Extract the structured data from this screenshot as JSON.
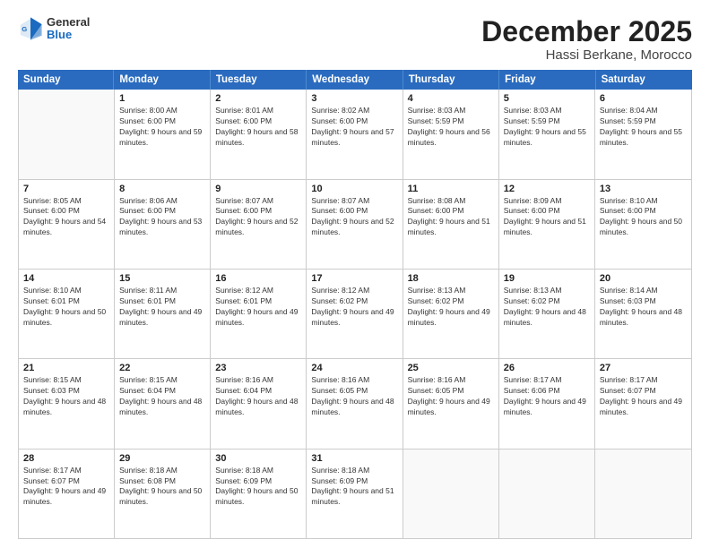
{
  "logo": {
    "general": "General",
    "blue": "Blue"
  },
  "title": "December 2025",
  "subtitle": "Hassi Berkane, Morocco",
  "days": [
    "Sunday",
    "Monday",
    "Tuesday",
    "Wednesday",
    "Thursday",
    "Friday",
    "Saturday"
  ],
  "weeks": [
    [
      {
        "day": "",
        "empty": true
      },
      {
        "day": "1",
        "sunrise": "8:00 AM",
        "sunset": "6:00 PM",
        "daylight": "9 hours and 59 minutes."
      },
      {
        "day": "2",
        "sunrise": "8:01 AM",
        "sunset": "6:00 PM",
        "daylight": "9 hours and 58 minutes."
      },
      {
        "day": "3",
        "sunrise": "8:02 AM",
        "sunset": "6:00 PM",
        "daylight": "9 hours and 57 minutes."
      },
      {
        "day": "4",
        "sunrise": "8:03 AM",
        "sunset": "5:59 PM",
        "daylight": "9 hours and 56 minutes."
      },
      {
        "day": "5",
        "sunrise": "8:03 AM",
        "sunset": "5:59 PM",
        "daylight": "9 hours and 55 minutes."
      },
      {
        "day": "6",
        "sunrise": "8:04 AM",
        "sunset": "5:59 PM",
        "daylight": "9 hours and 55 minutes."
      }
    ],
    [
      {
        "day": "7",
        "sunrise": "8:05 AM",
        "sunset": "6:00 PM",
        "daylight": "9 hours and 54 minutes."
      },
      {
        "day": "8",
        "sunrise": "8:06 AM",
        "sunset": "6:00 PM",
        "daylight": "9 hours and 53 minutes."
      },
      {
        "day": "9",
        "sunrise": "8:07 AM",
        "sunset": "6:00 PM",
        "daylight": "9 hours and 52 minutes."
      },
      {
        "day": "10",
        "sunrise": "8:07 AM",
        "sunset": "6:00 PM",
        "daylight": "9 hours and 52 minutes."
      },
      {
        "day": "11",
        "sunrise": "8:08 AM",
        "sunset": "6:00 PM",
        "daylight": "9 hours and 51 minutes."
      },
      {
        "day": "12",
        "sunrise": "8:09 AM",
        "sunset": "6:00 PM",
        "daylight": "9 hours and 51 minutes."
      },
      {
        "day": "13",
        "sunrise": "8:10 AM",
        "sunset": "6:00 PM",
        "daylight": "9 hours and 50 minutes."
      }
    ],
    [
      {
        "day": "14",
        "sunrise": "8:10 AM",
        "sunset": "6:01 PM",
        "daylight": "9 hours and 50 minutes."
      },
      {
        "day": "15",
        "sunrise": "8:11 AM",
        "sunset": "6:01 PM",
        "daylight": "9 hours and 49 minutes."
      },
      {
        "day": "16",
        "sunrise": "8:12 AM",
        "sunset": "6:01 PM",
        "daylight": "9 hours and 49 minutes."
      },
      {
        "day": "17",
        "sunrise": "8:12 AM",
        "sunset": "6:02 PM",
        "daylight": "9 hours and 49 minutes."
      },
      {
        "day": "18",
        "sunrise": "8:13 AM",
        "sunset": "6:02 PM",
        "daylight": "9 hours and 49 minutes."
      },
      {
        "day": "19",
        "sunrise": "8:13 AM",
        "sunset": "6:02 PM",
        "daylight": "9 hours and 48 minutes."
      },
      {
        "day": "20",
        "sunrise": "8:14 AM",
        "sunset": "6:03 PM",
        "daylight": "9 hours and 48 minutes."
      }
    ],
    [
      {
        "day": "21",
        "sunrise": "8:15 AM",
        "sunset": "6:03 PM",
        "daylight": "9 hours and 48 minutes."
      },
      {
        "day": "22",
        "sunrise": "8:15 AM",
        "sunset": "6:04 PM",
        "daylight": "9 hours and 48 minutes."
      },
      {
        "day": "23",
        "sunrise": "8:16 AM",
        "sunset": "6:04 PM",
        "daylight": "9 hours and 48 minutes."
      },
      {
        "day": "24",
        "sunrise": "8:16 AM",
        "sunset": "6:05 PM",
        "daylight": "9 hours and 48 minutes."
      },
      {
        "day": "25",
        "sunrise": "8:16 AM",
        "sunset": "6:05 PM",
        "daylight": "9 hours and 49 minutes."
      },
      {
        "day": "26",
        "sunrise": "8:17 AM",
        "sunset": "6:06 PM",
        "daylight": "9 hours and 49 minutes."
      },
      {
        "day": "27",
        "sunrise": "8:17 AM",
        "sunset": "6:07 PM",
        "daylight": "9 hours and 49 minutes."
      }
    ],
    [
      {
        "day": "28",
        "sunrise": "8:17 AM",
        "sunset": "6:07 PM",
        "daylight": "9 hours and 49 minutes."
      },
      {
        "day": "29",
        "sunrise": "8:18 AM",
        "sunset": "6:08 PM",
        "daylight": "9 hours and 50 minutes."
      },
      {
        "day": "30",
        "sunrise": "8:18 AM",
        "sunset": "6:09 PM",
        "daylight": "9 hours and 50 minutes."
      },
      {
        "day": "31",
        "sunrise": "8:18 AM",
        "sunset": "6:09 PM",
        "daylight": "9 hours and 51 minutes."
      },
      {
        "day": "",
        "empty": true
      },
      {
        "day": "",
        "empty": true
      },
      {
        "day": "",
        "empty": true
      }
    ]
  ]
}
